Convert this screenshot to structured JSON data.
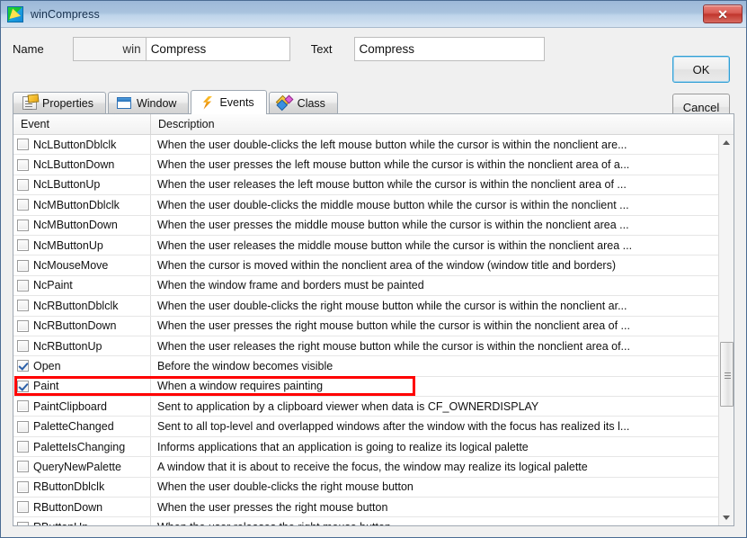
{
  "window": {
    "title": "winCompress",
    "icon": "app-window-cursor-icon",
    "close_label": "✕"
  },
  "form": {
    "name_label": "Name",
    "name_prefix": "win",
    "name_value": "Compress",
    "text_label": "Text",
    "text_value": "Compress",
    "ok_label": "OK",
    "cancel_label": "Cancel"
  },
  "tabs": [
    {
      "label": "Properties",
      "icon": "properties-document-icon",
      "active": false
    },
    {
      "label": "Window",
      "icon": "window-frame-icon",
      "active": false
    },
    {
      "label": "Events",
      "icon": "lightning-bolt-icon",
      "active": true
    },
    {
      "label": "Class",
      "icon": "class-diamond-icon",
      "active": false
    }
  ],
  "grid": {
    "columns": [
      "Event",
      "Description"
    ],
    "highlight_row_index": 12,
    "highlight_color": "#ff0000",
    "rows": [
      {
        "checked": false,
        "event": "NcLButtonDblclk",
        "description": "When the user double-clicks the left mouse button while the cursor is within the nonclient are..."
      },
      {
        "checked": false,
        "event": "NcLButtonDown",
        "description": "When the user presses the left mouse button while the cursor is within the nonclient area of a..."
      },
      {
        "checked": false,
        "event": "NcLButtonUp",
        "description": "When the user releases the left mouse button while the cursor is within the nonclient area of ..."
      },
      {
        "checked": false,
        "event": "NcMButtonDblclk",
        "description": "When the user double-clicks the middle mouse button while the cursor is within the nonclient ..."
      },
      {
        "checked": false,
        "event": "NcMButtonDown",
        "description": "When the user presses the middle mouse button while the cursor is within the nonclient area ..."
      },
      {
        "checked": false,
        "event": "NcMButtonUp",
        "description": "When the user releases the middle mouse button while the cursor is within the nonclient area ..."
      },
      {
        "checked": false,
        "event": "NcMouseMove",
        "description": "When the cursor is moved within the nonclient area of the window (window title and borders)"
      },
      {
        "checked": false,
        "event": "NcPaint",
        "description": "When the window frame and borders must be painted"
      },
      {
        "checked": false,
        "event": "NcRButtonDblclk",
        "description": "When the user double-clicks the right mouse button while the cursor is within the nonclient ar..."
      },
      {
        "checked": false,
        "event": "NcRButtonDown",
        "description": "When the user presses the right mouse button while the cursor is within the nonclient area of ..."
      },
      {
        "checked": false,
        "event": "NcRButtonUp",
        "description": "When the user releases the right mouse button while the cursor is within the nonclient area of..."
      },
      {
        "checked": true,
        "event": "Open",
        "description": "Before the window becomes visible"
      },
      {
        "checked": true,
        "event": "Paint",
        "description": "When a window requires painting"
      },
      {
        "checked": false,
        "event": "PaintClipboard",
        "description": "Sent to application by a clipboard viewer when data is CF_OWNERDISPLAY"
      },
      {
        "checked": false,
        "event": "PaletteChanged",
        "description": "Sent to all top-level and overlapped windows after the window with the focus has realized its l..."
      },
      {
        "checked": false,
        "event": "PaletteIsChanging",
        "description": "Informs applications that an application is going to realize its logical palette"
      },
      {
        "checked": false,
        "event": "QueryNewPalette",
        "description": "A window that it is about to receive the focus, the window may realize its logical palette"
      },
      {
        "checked": false,
        "event": "RButtonDblclk",
        "description": "When the user double-clicks the right mouse button"
      },
      {
        "checked": false,
        "event": "RButtonDown",
        "description": "When the user presses the right mouse button"
      },
      {
        "checked": false,
        "event": "RButtonUp",
        "description": "When the user releases the right mouse button"
      }
    ]
  },
  "scrollbar": {
    "up_arrow": "▲",
    "down_arrow": "▼"
  }
}
